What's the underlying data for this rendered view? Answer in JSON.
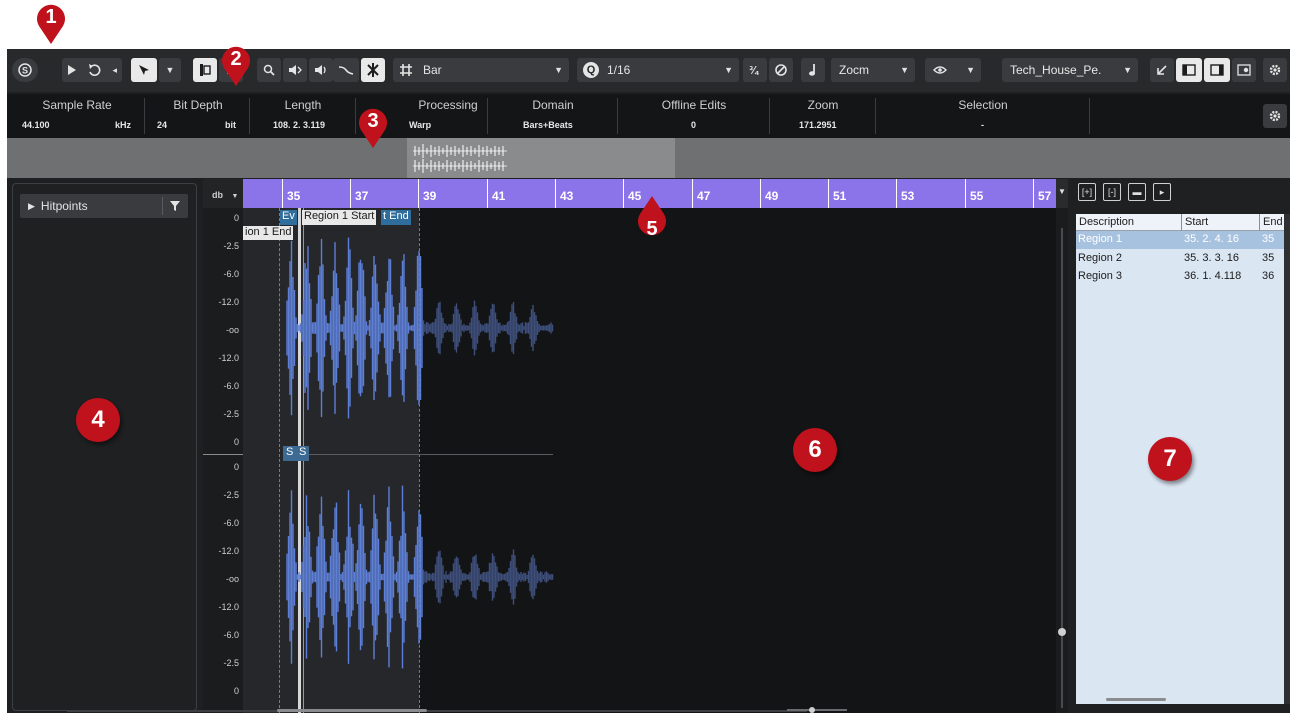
{
  "toolbar": {
    "snap_type": "Bar",
    "quantize_value": "1/16",
    "zoom_mode": "Zocm",
    "preset": "Tech_House_Pe.",
    "quantize_letter": "Q"
  },
  "infoline": [
    {
      "label": "Sample Rate",
      "value": "44.100",
      "unit": "kHz"
    },
    {
      "label": "Bit Depth",
      "value": "24",
      "unit": "bit"
    },
    {
      "label": "Length",
      "value": "108. 2. 3.119"
    },
    {
      "label": "Processing",
      "value": "Warp"
    },
    {
      "label": "Domain",
      "value": "Bars+Beats"
    },
    {
      "label": "Offline Edits",
      "value": "0"
    },
    {
      "label": "Zoom",
      "value": "171.2951"
    },
    {
      "label": "Selection",
      "value": "-"
    }
  ],
  "left_zone": {
    "hitpoints_label": "Hitpoints"
  },
  "editor": {
    "db_header": "db",
    "ruler_labels": [
      "35",
      "37",
      "39",
      "41",
      "43",
      "45",
      "47",
      "49",
      "51",
      "53",
      "55",
      "57"
    ],
    "db_scale_top": [
      "0",
      "-2.5",
      "-6.0",
      "-12.0",
      "-oo",
      "-12.0",
      "-6.0",
      "-2.5",
      "0"
    ],
    "db_scale_bottom": [
      "0",
      "-2.5",
      "-6.0",
      "-12.0",
      "-oo",
      "-12.0",
      "-6.0",
      "-2.5",
      "0"
    ],
    "markers": {
      "ev": "Ev",
      "region_start": "Region 1 Start",
      "end_tail": "t End",
      "region_end": "ion 1 End",
      "s1": "S",
      "s2": "S"
    }
  },
  "regions": {
    "columns": [
      "Description",
      "Start",
      "End"
    ],
    "rows": [
      {
        "description": "Region 1",
        "start": "35. 2. 4. 16",
        "end": "35",
        "selected": true
      },
      {
        "description": "Region 2",
        "start": "35. 3. 3. 16",
        "end": "35",
        "selected": false
      },
      {
        "description": "Region 3",
        "start": "36. 1. 4.118",
        "end": "36",
        "selected": false
      }
    ]
  },
  "callouts": [
    "1",
    "2",
    "3",
    "4",
    "5",
    "6",
    "7"
  ],
  "colors": {
    "ruler": "#8b73ea",
    "waveform": "#5d7fd6",
    "callout": "#c0121c",
    "region_list_bg": "#dbe6f3"
  }
}
